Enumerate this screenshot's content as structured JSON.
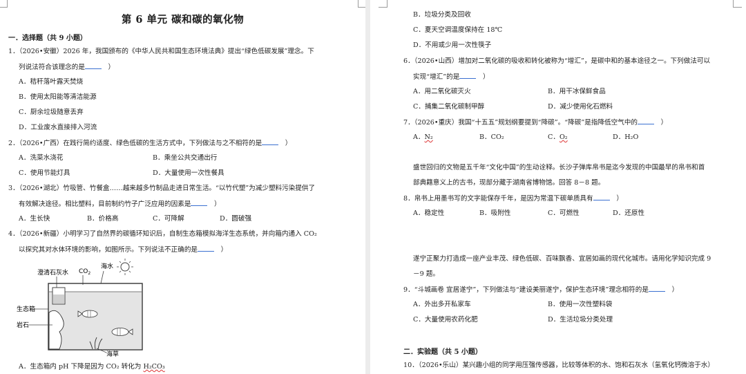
{
  "doc": {
    "title": "第 6 单元  碳和碳的氧化物",
    "section1": "一．选择题（共 9 小题）",
    "section2": "二．实验题（共 5 小题）"
  },
  "left": {
    "q1_l1": "1．（2026•安徽）2026 年，我国颁布的《中华人民共和国生态环境法典》提出“绿色低碳发展”理念。下",
    "q1_l2": "列说法符合该理念的是",
    "q1_l2_end": "）",
    "q1_a": "A．秸秆落叶露天焚烧",
    "q1_b": "B．使用太阳能等清洁能源",
    "q1_c": "C．厨余垃圾随意丢弃",
    "q1_d": "D．工业废水直接排入河流",
    "q2_l1": "2．（2026•广西）在践行简约适度、绿色低碳的生活方式中，下列做法与之不相符的是",
    "q2_end": "）",
    "q2_a": "A．洗菜水浇花",
    "q2_b": "B．乘坐公共交通出行",
    "q2_c": "C．使用节能灯具",
    "q2_d": "D．大量使用一次性餐具",
    "q3_l1": "3．（2026•湖北）竹吸管、竹餐盒……越来越多竹制品走进日常生活。“以竹代塑”为减少塑料污染提供了",
    "q3_l2": "有效解决途径。相比塑料，目前制约竹子广泛应用的因素是",
    "q3_end": "）",
    "q3_a": "A．生长快",
    "q3_b": "B．价格高",
    "q3_c": "C．可降解",
    "q3_d": "D．圆破强",
    "q4_l1": "4．（2026•新疆）小明学习了自然界的碳循环知识后，自制生态箱模拟海洋生态系统，并向箱内通入 CO₂",
    "q4_l2": "以探究其对水体环境的影响，如图所示。下列说法不正确的是",
    "q4_end": "）",
    "q4_a_pre": "A．生态箱内 pH 下降是因为 CO₂ 转化为 ",
    "q4_a_chem": "H₂CO₃"
  },
  "figure": {
    "limewater": "澄清石灰水",
    "co2": "CO",
    "co2_sub": "2",
    "seawater": "海水",
    "eco_box": "生态箱",
    "rock": "岩石",
    "seaweed": "海草"
  },
  "right": {
    "q5_b": "B．垃圾分类及回收",
    "q5_c": "C．夏天空调温度保持在 18℃",
    "q5_d": "D．不用或少用一次性筷子",
    "q6_l1": "6．（2026•山西）增加对二氧化碳的吸收和转化被称为“增汇”，是碳中和的基本途径之一。下列做法可以",
    "q6_l2": "实现“增汇”的是",
    "q6_end": "）",
    "q6_a": "A．用二氧化碳灭火",
    "q6_b": "B．用干冰保鲜食品",
    "q6_c": "C．捕集二氧化碳制甲醇",
    "q6_d": "D．减少使用化石燃料",
    "q7_l1": "7．（2026•重庆）我国“十五五”规划纲要提到“降碳”。“降碳”是指降低空气中的",
    "q7_end": "）",
    "q7_a_pre": "A．",
    "q7_a_chem": "N₂",
    "q7_b": "B．CO₂",
    "q7_c_pre": "C．",
    "q7_c_chem": "O₂",
    "q7_d": "D．H₂O",
    "p1_l1": "盛世回归的文物是五千年“文化中国”的生动诠释。长沙子弹库帛书是迄今发现的中国最早的帛书和首",
    "p1_l2": "部典籍意义上的古书，现部分藏于湖南省博物馆。回答 8－8 题。",
    "q8_l1": "8．帛书上用墨书写的文字能保存千年，是因为常温下碳单质具有",
    "q8_end": "）",
    "q8_a": "A．稳定性",
    "q8_b": "B．吸附性",
    "q8_c": "C．可燃性",
    "q8_d": "D．还原性",
    "p2_l1": "遂宁正聚力打造成一座产业丰茂、绿色低碳、百味飘香、宜居如画的现代化城市。请用化学知识完成 9",
    "p2_l2": "－9 题。",
    "q9_l1": "9．“斗城画卷 宜居遂宁”，下列做法与“建设美丽遂宁，保护生态环境”理念相符的是",
    "q9_end": "）",
    "q9_a": "A．外出多开私家车",
    "q9_b": "B．使用一次性塑料袋",
    "q9_c": "C．大量使用农药化肥",
    "q9_d": "D．生活垃圾分类处理",
    "q10_l1": "10．（2026•乐山）某兴趣小组的同学用压强传感器，比较等体积的水、饱和石灰水（氢氧化钙微溶于水）"
  }
}
